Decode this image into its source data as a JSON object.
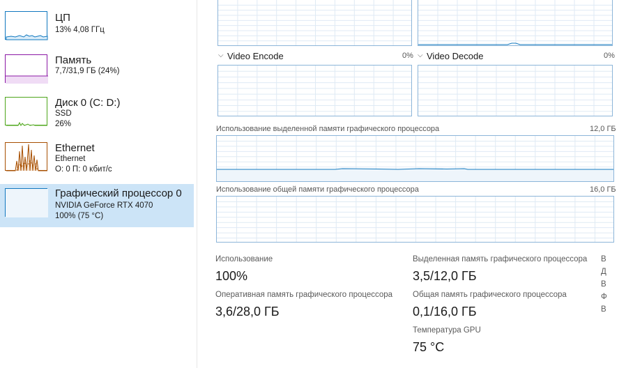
{
  "sidebar": {
    "items": [
      {
        "title": "ЦП",
        "line1": "13%  4,08 ГГц",
        "line2": "",
        "line3": "",
        "color": "#1178bf"
      },
      {
        "title": "Память",
        "line1": "7,7/31,9 ГБ (24%)",
        "line2": "",
        "line3": "",
        "color": "#8b18a5"
      },
      {
        "title": "Диск 0 (C: D:)",
        "line1": "SSD",
        "line2": "26%",
        "line3": "",
        "color": "#4da61a"
      },
      {
        "title": "Ethernet",
        "line1": "Ethernet",
        "line2": "О: 0 П: 0 кбит/с",
        "line3": "",
        "color": "#a74f01"
      },
      {
        "title": "Графический процессор 0",
        "line1": "NVIDIA GeForce RTX 4070",
        "line2": "100%  (75 °C)",
        "line3": "",
        "color": "#1178bf"
      }
    ]
  },
  "graphs": {
    "video_encode": {
      "label": "Video Encode",
      "pct": "0%"
    },
    "video_decode": {
      "label": "Video Decode",
      "pct": "0%"
    },
    "dedicated": {
      "label": "Использование выделенной памяти графического процессора",
      "max": "12,0 ГБ"
    },
    "shared": {
      "label": "Использование общей памяти графического процессора",
      "max": "16,0 ГБ"
    }
  },
  "stats": {
    "usage_label": "Использование",
    "usage_value": "100%",
    "gpu_ram_label": "Оперативная память графического процессора",
    "gpu_ram_value": "3,6/28,0 ГБ",
    "dedicated_label": "Выделенная память графического процессора",
    "dedicated_value": "3,5/12,0 ГБ",
    "shared_label": "Общая память графического процессора",
    "shared_value": "0,1/16,0 ГБ",
    "temp_label": "Температура GPU",
    "temp_value": "75 °C"
  },
  "right_column": [
    "В",
    "Д",
    "В",
    "Ф",
    "В"
  ],
  "colors": {
    "accent": "#1178bf",
    "graph_border": "#8cb5d9",
    "grid": "#dfeaf4",
    "selected_bg": "#cce4f7"
  }
}
